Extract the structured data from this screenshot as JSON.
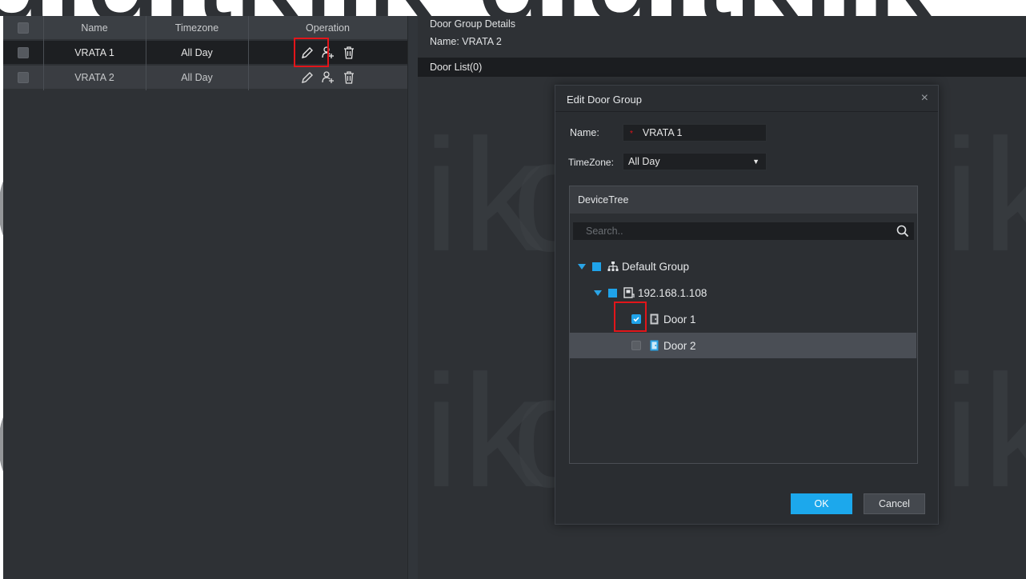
{
  "watermark": {
    "text": "digitklik",
    "top_strip_text": "digitklik digitklik"
  },
  "door_groups": {
    "headers": {
      "name": "Name",
      "timezone": "Timezone",
      "operation": "Operation"
    },
    "rows": [
      {
        "name": "VRATA 1",
        "timezone": "All Day",
        "selected": true
      },
      {
        "name": "VRATA 2",
        "timezone": "All Day",
        "selected": false
      }
    ],
    "operation_icons": [
      "edit-icon",
      "add-user-icon",
      "delete-icon"
    ]
  },
  "details": {
    "title": "Door Group Details",
    "name_line": "Name: VRATA 2",
    "door_list": "Door  List(0)"
  },
  "dialog": {
    "title": "Edit Door Group",
    "close_symbol": "×",
    "name_label": "Name:",
    "required_mark": "*",
    "name_value": "VRATA 1",
    "timezone_label": "TimeZone:",
    "timezone_value": "All Day",
    "timezone_caret": "▼",
    "device_tree": {
      "title": "DeviceTree",
      "search_placeholder": "Search..",
      "nodes": [
        {
          "label": "Default Group",
          "level": 0,
          "icon": "group-icon",
          "expanded": true
        },
        {
          "label": "192.168.1.108",
          "level": 1,
          "icon": "device-icon",
          "expanded": true
        },
        {
          "label": "Door 1",
          "level": 2,
          "icon": "door-icon",
          "checked": true
        },
        {
          "label": "Door 2",
          "level": 2,
          "icon": "door-icon",
          "checked": false,
          "selected": true
        }
      ]
    },
    "ok_label": "OK",
    "cancel_label": "Cancel"
  },
  "colors": {
    "background": "#2e3135",
    "accent_blue": "#1ca8ec",
    "highlight_red": "#e2151a"
  }
}
